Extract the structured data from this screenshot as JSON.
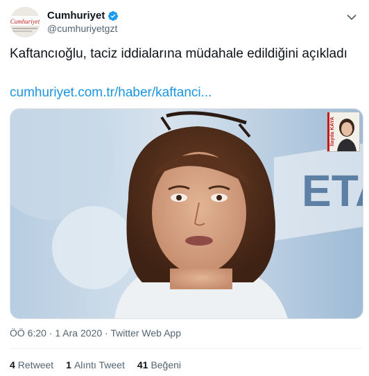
{
  "user": {
    "display_name": "Cumhuriyet",
    "handle": "@cumhuriyetgzt",
    "avatar_text": "Cumhuriyet",
    "verified": true
  },
  "tweet": {
    "text": "Kaftancıoğlu, taciz iddialarına müdahale edildiğini açıkladı",
    "link": "cumhuriyet.com.tr/haber/kaftanci..."
  },
  "media": {
    "description_icon": "photo",
    "inset_name": "İlayda KAYA",
    "backdrop_text": "ETA"
  },
  "meta": {
    "time": "ÖÖ 6:20",
    "separator1": " · ",
    "date": "1 Ara 2020",
    "separator2": " · ",
    "source": "Twitter Web App"
  },
  "stats": {
    "retweets_count": "4",
    "retweets_label": "Retweet",
    "quotes_count": "1",
    "quotes_label": "Alıntı Tweet",
    "likes_count": "41",
    "likes_label": "Beğeni"
  },
  "colors": {
    "link": "#1b95e0",
    "verified": "#1d9bf0",
    "secondary_text": "#536471"
  }
}
